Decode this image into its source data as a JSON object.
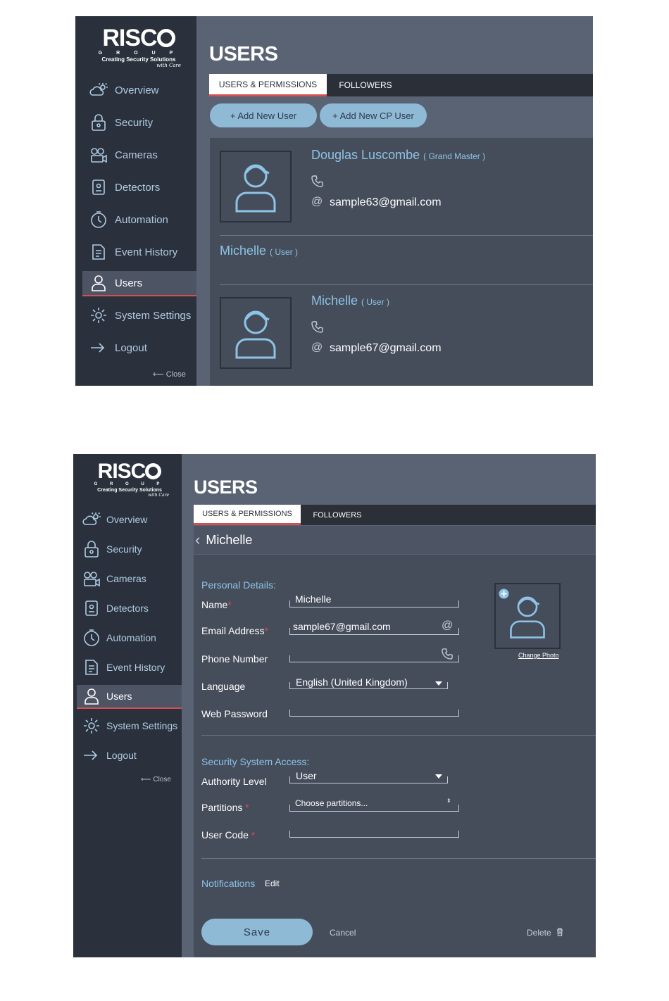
{
  "brand": {
    "name": "RISC",
    "group": "G R O U P",
    "tagline": "Creating Security Solutions",
    "tagline_script": "with Care"
  },
  "nav": {
    "items": [
      {
        "label": "Overview",
        "icon": "cloud-sun-icon"
      },
      {
        "label": "Security",
        "icon": "lock-icon"
      },
      {
        "label": "Cameras",
        "icon": "camera-icon"
      },
      {
        "label": "Detectors",
        "icon": "detector-icon"
      },
      {
        "label": "Automation",
        "icon": "clock-icon"
      },
      {
        "label": "Event History",
        "icon": "document-icon"
      },
      {
        "label": "Users",
        "icon": "user-icon",
        "active": true
      },
      {
        "label": "System Settings",
        "icon": "gear-icon"
      },
      {
        "label": "Logout",
        "icon": "logout-icon"
      }
    ],
    "close_label": "Close"
  },
  "users_list": {
    "title": "USERS",
    "tabs": [
      "USERS & PERMISSIONS",
      "FOLLOWERS"
    ],
    "buttons": [
      "+ Add New User",
      "+ Add New CP User"
    ],
    "users": [
      {
        "name": "Douglas Luscombe",
        "role": "( Grand Master )",
        "email": "sample63@gmail.com"
      },
      {
        "name": "Michelle",
        "role": "( User )"
      },
      {
        "name": "Michelle",
        "role": "( User )",
        "email": "sample67@gmail.com"
      }
    ]
  },
  "user_edit": {
    "title": "USERS",
    "tabs": [
      "USERS & PERMISSIONS",
      "FOLLOWERS"
    ],
    "back_title": "Michelle",
    "personal_details_label": "Personal Details:",
    "fields": {
      "name_label": "Name",
      "name_value": "Michelle",
      "email_label": "Email Address",
      "email_value": "sample67@gmail.com",
      "phone_label": "Phone Number",
      "phone_value": "",
      "language_label": "Language",
      "language_value": "English (United Kingdom)",
      "web_password_label": "Web Password"
    },
    "change_photo_label": "Change Photo",
    "security_access_label": "Security System Access:",
    "authority_label": "Authority Level",
    "authority_value": "User",
    "partitions_label": "Partitions",
    "partitions_placeholder": "Choose partitions...",
    "user_code_label": "User Code",
    "notifications_label": "Notifications",
    "notifications_edit": "Edit",
    "save_label": "Save",
    "cancel_label": "Cancel",
    "delete_label": "Delete"
  },
  "colors": {
    "sidebar": "#2b313c",
    "main": "#596374",
    "content": "#454d5b",
    "accent": "#8ec3e6",
    "button": "#8fbad6",
    "active_underline": "#d45050"
  }
}
